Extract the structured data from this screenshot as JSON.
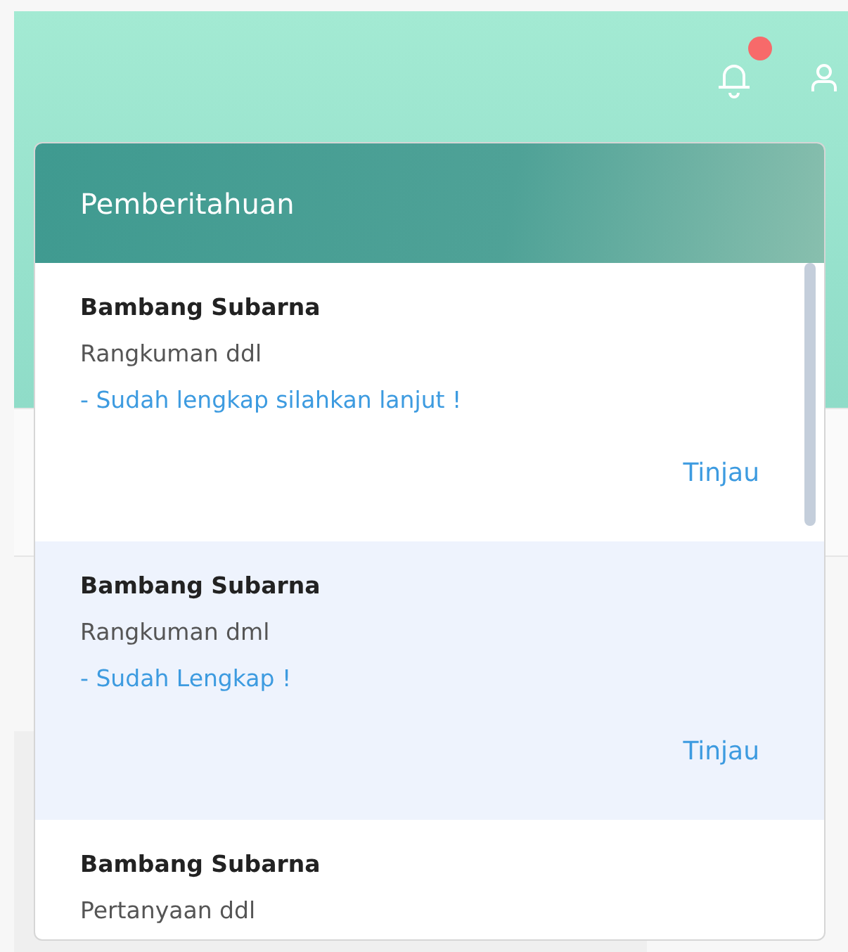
{
  "header": {
    "notification_badge": true
  },
  "notifications": {
    "title": "Pemberitahuan",
    "items": [
      {
        "sender": "Bambang Subarna",
        "subject": "Rangkuman ddl",
        "status": "- Sudah lengkap silahkan lanjut !",
        "action": "Tinjau",
        "unread": false
      },
      {
        "sender": "Bambang Subarna",
        "subject": "Rangkuman dml",
        "status": "- Sudah Lengkap !",
        "action": "Tinjau",
        "unread": true
      },
      {
        "sender": "Bambang Subarna",
        "subject": "Pertanyaan ddl",
        "unread": false
      }
    ]
  }
}
